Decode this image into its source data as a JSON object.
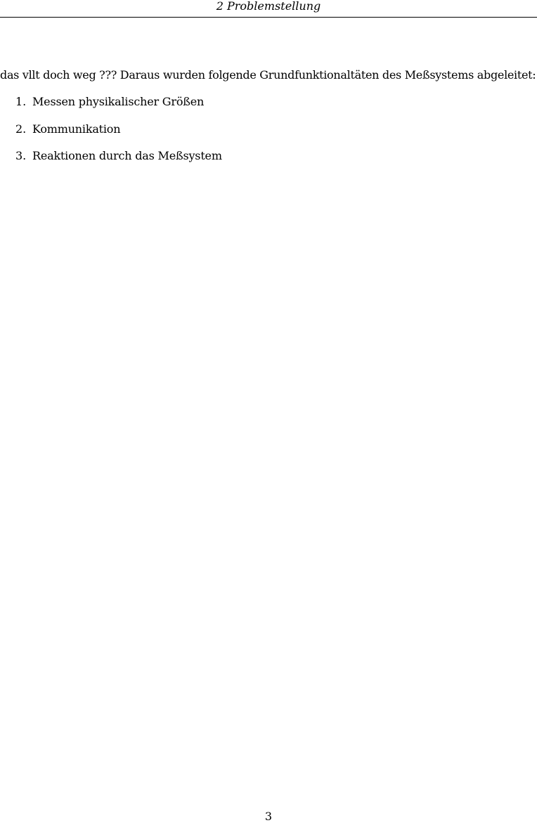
{
  "header": {
    "running_title": "2  Problemstellung"
  },
  "body": {
    "paragraph": "das vllt doch weg ??? Daraus wurden folgende Grundfunktionaltäten des Meßsystems abgeleitet:"
  },
  "list": {
    "items": [
      {
        "number": "1.",
        "text": "Messen physikalischer Größen"
      },
      {
        "number": "2.",
        "text": "Kommunikation"
      },
      {
        "number": "3.",
        "text": "Reaktionen durch das Meßsystem"
      }
    ]
  },
  "footer": {
    "page_number": "3"
  }
}
